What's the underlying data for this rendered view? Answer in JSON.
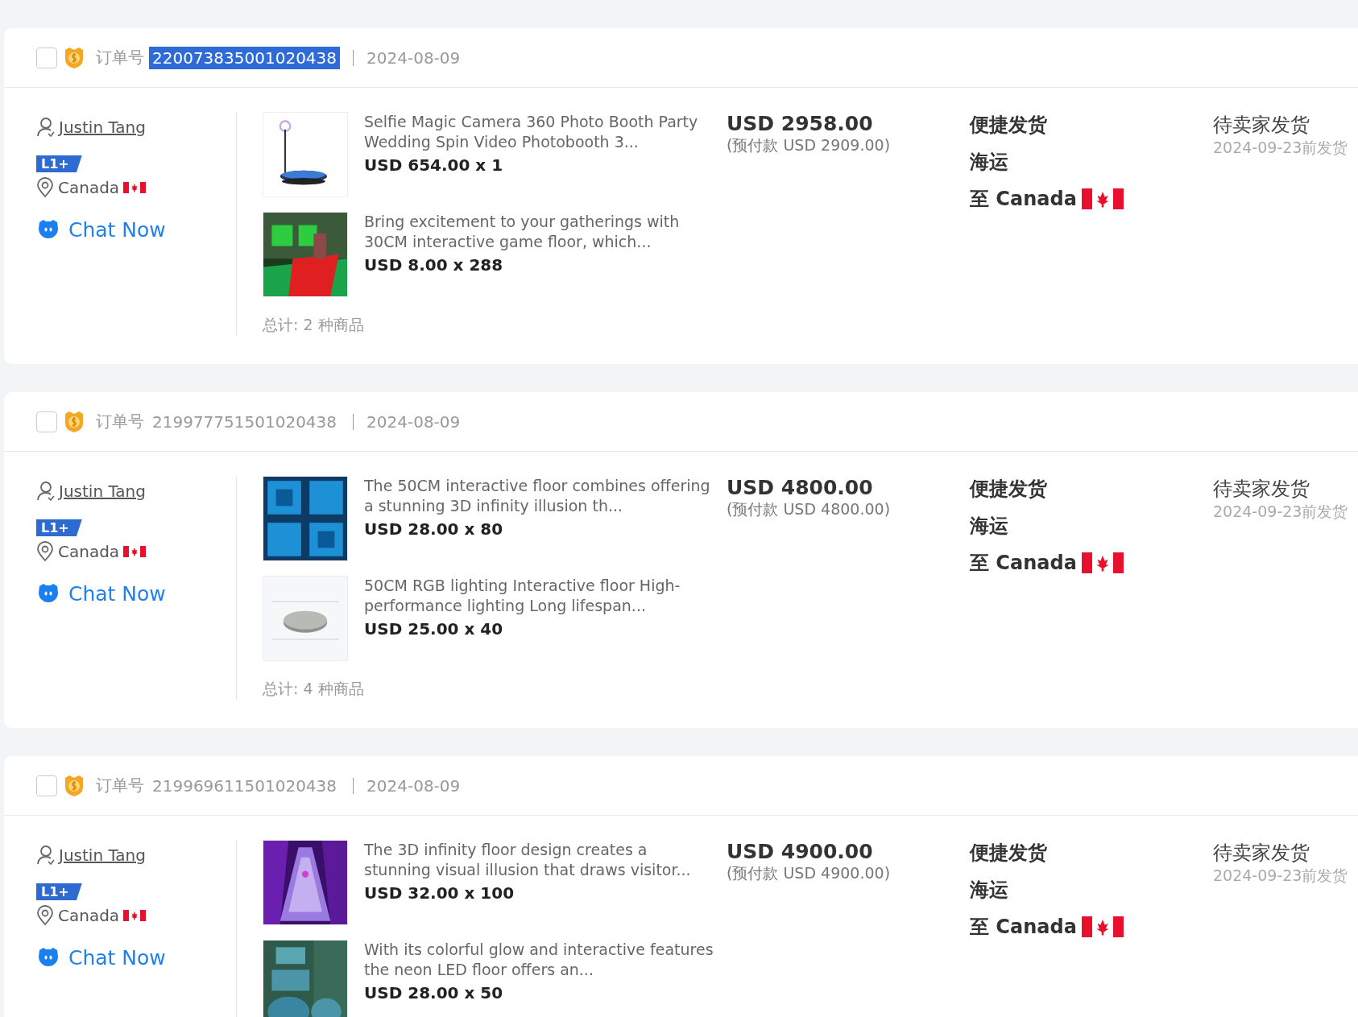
{
  "orders": [
    {
      "checked": false,
      "order_label": "订单号",
      "order_number": "220073835001020438",
      "number_highlighted": true,
      "date": "2024-08-09",
      "buyer": "Justin Tang",
      "level_badge": "L1+",
      "country": "Canada",
      "chat": "Chat Now",
      "products": [
        {
          "title": "Selfie Magic Camera 360 Photo Booth Party Wedding Spin Video Photobooth 3...",
          "price": "USD 654.00 x 1"
        },
        {
          "title": "Bring excitement to your gatherings with 30CM interactive game floor, which...",
          "price": "USD 8.00 x 288"
        }
      ],
      "total": "总计: 2 种商品",
      "amount": "USD 2958.00",
      "prepaid": "(预付款 USD 2909.00)",
      "shipping_type": "便捷发货",
      "shipping_method": "海运",
      "destination": "至 Canada",
      "status": "待卖家发货",
      "deadline": "2024-09-23前发货"
    },
    {
      "checked": false,
      "order_label": "订单号",
      "order_number": "219977751501020438",
      "number_highlighted": false,
      "date": "2024-08-09",
      "buyer": "Justin Tang",
      "level_badge": "L1+",
      "country": "Canada",
      "chat": "Chat Now",
      "products": [
        {
          "title": "The 50CM interactive floor combines offering a stunning 3D infinity illusion th...",
          "price": "USD 28.00 x 80"
        },
        {
          "title": "50CM RGB lighting Interactive floor High-performance lighting Long lifespan...",
          "price": "USD 25.00 x 40"
        }
      ],
      "total": "总计: 4 种商品",
      "amount": "USD 4800.00",
      "prepaid": "(预付款 USD 4800.00)",
      "shipping_type": "便捷发货",
      "shipping_method": "海运",
      "destination": "至 Canada",
      "status": "待卖家发货",
      "deadline": "2024-09-23前发货"
    },
    {
      "checked": false,
      "order_label": "订单号",
      "order_number": "219969611501020438",
      "number_highlighted": false,
      "date": "2024-08-09",
      "buyer": "Justin Tang",
      "level_badge": "L1+",
      "country": "Canada",
      "chat": "Chat Now",
      "products": [
        {
          "title": "The 3D infinity floor design creates a stunning visual illusion that draws visitor...",
          "price": "USD 32.00 x 100"
        },
        {
          "title": "With its colorful glow and interactive features the neon LED floor offers an...",
          "price": "USD 28.00 x 50"
        }
      ],
      "amount": "USD 4900.00",
      "prepaid": "(预付款 USD 4900.00)",
      "shipping_type": "便捷发货",
      "shipping_method": "海运",
      "destination": "至 Canada",
      "status": "待卖家发货",
      "deadline": "2024-09-23前发货"
    }
  ]
}
